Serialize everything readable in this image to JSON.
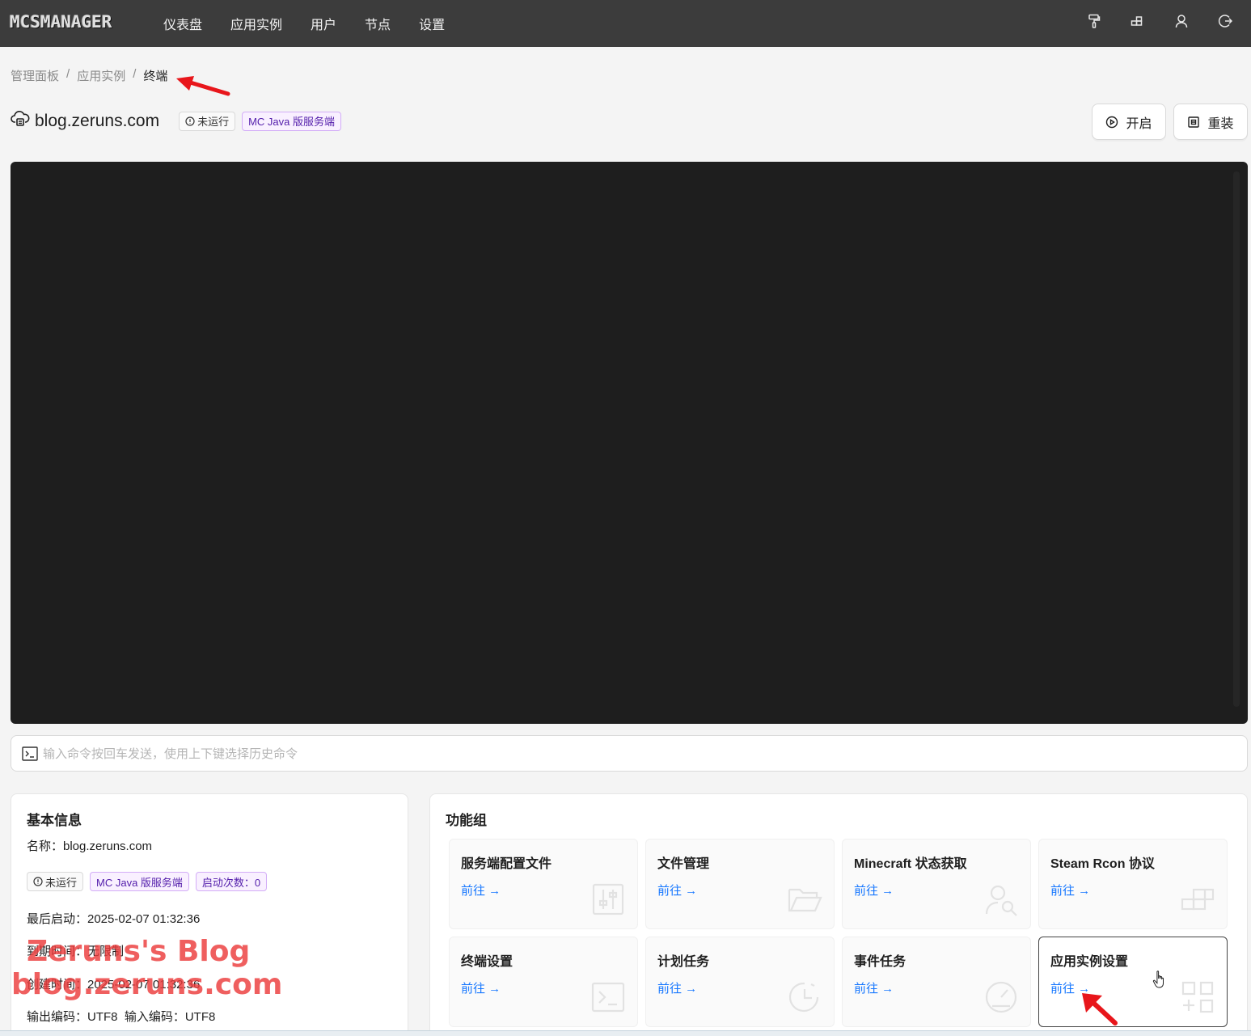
{
  "app": {
    "logo_text": "MCSMANAGER",
    "nav": [
      "仪表盘",
      "应用实例",
      "用户",
      "节点",
      "设置"
    ]
  },
  "top_icons": [
    "paint-roller-icon",
    "blocks-icon",
    "user-icon",
    "logout-icon"
  ],
  "breadcrumb": [
    "管理面板",
    "应用实例",
    "终端"
  ],
  "instance": {
    "name": "blog.zeruns.com",
    "status": "未运行",
    "type": "MC Java 版服务端"
  },
  "actions": {
    "start": "开启",
    "reinstall": "重装"
  },
  "terminal": {
    "placeholder": "输入命令按回车发送，使用上下键选择历史命令"
  },
  "basic_info": {
    "title": "基本信息",
    "name_line": "名称：blog.zeruns.com",
    "tags": {
      "status": "未运行",
      "type": "MC Java 版服务端",
      "launch_count": "启动次数：0"
    },
    "last_start": "最后启动：2025-02-07 01:32:36",
    "expire": "到期时间：无限制",
    "created": "创建时间：2025-02-07 01:32:36",
    "encoding": "输出编码：UTF8  输入编码：UTF8"
  },
  "function_group": {
    "title": "功能组",
    "go_label": "前往",
    "items": [
      {
        "title": "服务端配置文件",
        "icon": "sliders-icon"
      },
      {
        "title": "文件管理",
        "icon": "folder-icon"
      },
      {
        "title": "Minecraft 状态获取",
        "icon": "user-search-icon"
      },
      {
        "title": "Steam Rcon 协议",
        "icon": "blocks-icon"
      },
      {
        "title": "终端设置",
        "icon": "terminal-icon"
      },
      {
        "title": "计划任务",
        "icon": "clock-icon"
      },
      {
        "title": "事件任务",
        "icon": "gauge-icon"
      },
      {
        "title": "应用实例设置",
        "icon": "app-add-icon"
      }
    ]
  },
  "watermark": {
    "line1": "Zeruns's Blog",
    "line2": "blog.zeruns.com"
  },
  "colors": {
    "topbar": "#3c3c3c",
    "terminal_bg": "#1e1e1e",
    "link": "#1677ff",
    "purple_tag": "#531dab",
    "annotation_red": "#e8161b"
  }
}
